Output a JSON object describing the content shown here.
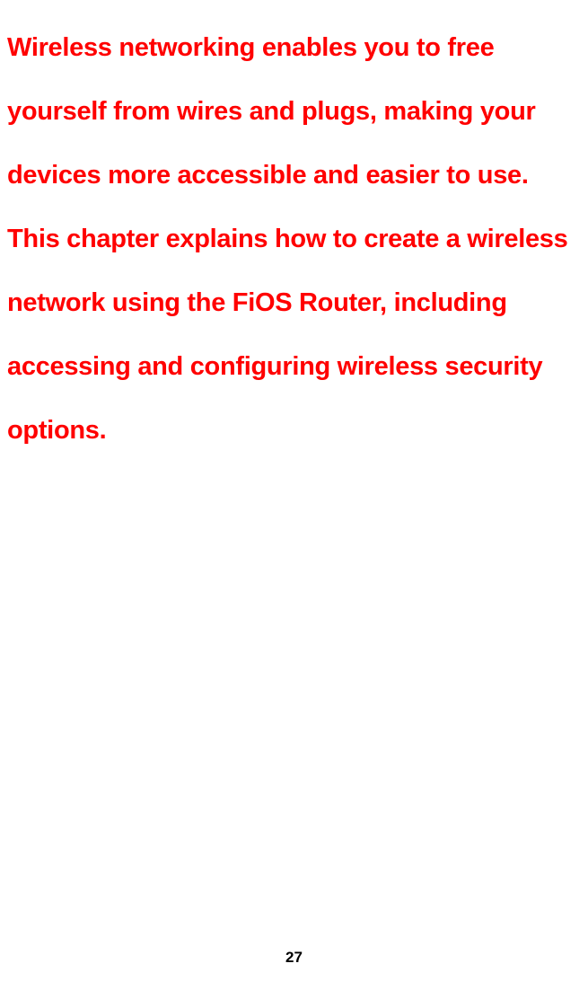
{
  "content": {
    "intro": "Wireless networking enables you to free yourself from wires and plugs, making your devices more accessible and easier to use. This chapter explains how to create a wireless network using the FiOS Router, including accessing and configuring wireless security options."
  },
  "page_number": "27"
}
